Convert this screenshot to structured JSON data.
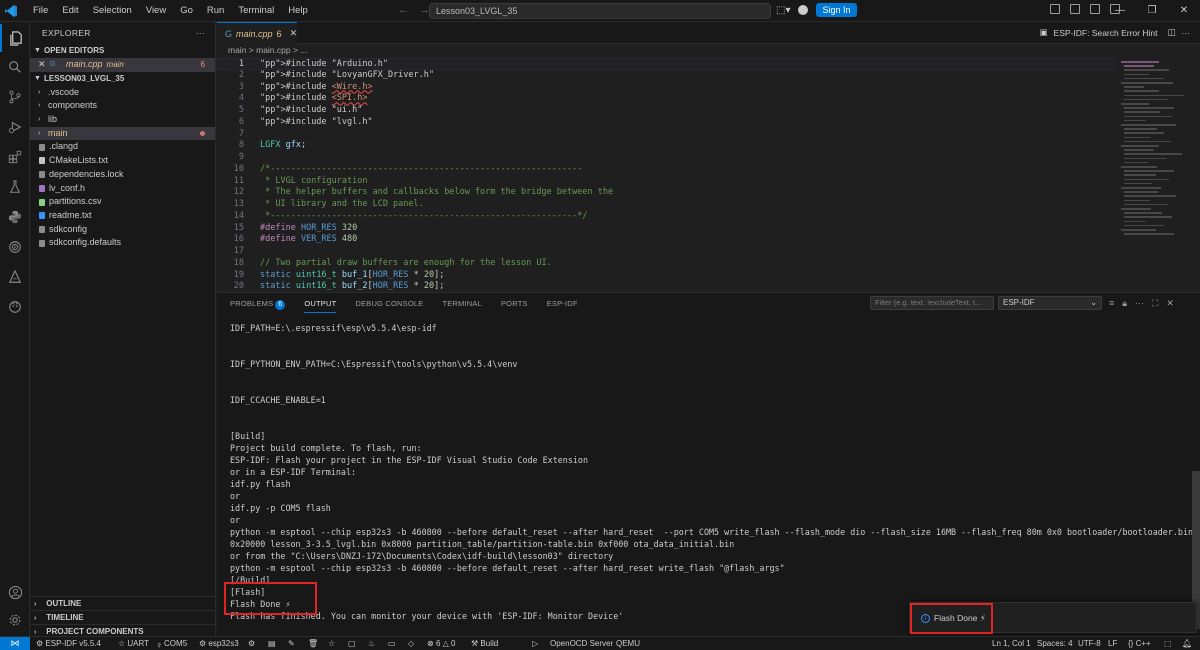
{
  "titlebar": {
    "menu": [
      "File",
      "Edit",
      "Selection",
      "View",
      "Go",
      "Run",
      "Terminal",
      "Help"
    ],
    "command_center": "Lesson03_LVGL_35",
    "sign_in": "Sign In"
  },
  "sidebar": {
    "title": "EXPLORER",
    "open_editors": "OPEN EDITORS",
    "open_file": "main.cpp",
    "open_file_dir": "main",
    "open_file_problems": "6",
    "project": "LESSON03_LVGL_35",
    "items": [
      {
        "label": "vscode",
        "type": "folder"
      },
      {
        "label": "components",
        "type": "folder"
      },
      {
        "label": "lib",
        "type": "folder"
      },
      {
        "label": "main",
        "type": "folder-modified"
      },
      {
        "label": ".clangd",
        "type": "file"
      },
      {
        "label": "CMakeLists.txt",
        "type": "cmake"
      },
      {
        "label": "dependencies.lock",
        "type": "file"
      },
      {
        "label": "lv_conf.h",
        "type": "header"
      },
      {
        "label": "partitions.csv",
        "type": "csv"
      },
      {
        "label": "readme.txt",
        "type": "info"
      },
      {
        "label": "sdkconfig",
        "type": "file"
      },
      {
        "label": "sdkconfig.defaults",
        "type": "file"
      }
    ],
    "outline": "OUTLINE",
    "timeline": "TIMELINE",
    "project_components": "PROJECT COMPONENTS"
  },
  "editor": {
    "tab_label": "main.cpp",
    "tab_problems": "6",
    "breadcrumb": "main > main.cpp > ...",
    "right_action": "ESP-IDF: Search Error Hint",
    "lines": [
      "#include \"Arduino.h\"",
      "#include \"LovyanGFX_Driver.h\"",
      "#include <Wire.h>",
      "#include <SPI.h>",
      "#include \"ui.h\"",
      "#include \"lvgl.h\"",
      "",
      "LGFX gfx;",
      "",
      "/*-------------------------------------------------------------",
      " * LVGL configuration",
      " * The helper buffers and callbacks below form the bridge between the",
      " * UI library and the LCD panel.",
      " *------------------------------------------------------------*/",
      "#define HOR_RES 320",
      "#define VER_RES 480",
      "",
      "// Two partial draw buffers are enough for the lesson UI.",
      "static uint16_t buf_1[HOR_RES * 20];",
      "static uint16_t buf_2[HOR_RES * 20];"
    ]
  },
  "panel": {
    "tabs": [
      "PROBLEMS",
      "OUTPUT",
      "DEBUG CONSOLE",
      "TERMINAL",
      "PORTS",
      "ESP-IDF"
    ],
    "problems_count": "6",
    "filter_placeholder": "Filter (e.g. text, !excludeText, t...",
    "channel": "ESP-IDF",
    "output_lines": [
      "IDF_PATH=E:\\.espressif\\esp\\v5.5.4\\esp-idf",
      "",
      "",
      "IDF_PYTHON_ENV_PATH=C:\\Espressif\\tools\\python\\v5.5.4\\venv",
      "",
      "",
      "IDF_CCACHE_ENABLE=1",
      "",
      "",
      "[Build]",
      "Project build complete. To flash, run:",
      "ESP-IDF: Flash your project in the ESP-IDF Visual Studio Code Extension",
      "or in a ESP-IDF Terminal:",
      "idf.py flash",
      "or",
      "idf.py -p COM5 flash",
      "or",
      "python -m esptool --chip esp32s3 -b 460800 --before default_reset --after hard_reset  --port COM5 write_flash --flash_mode dio --flash_size 16MB --flash_freq 80m 0x0 bootloader/bootloader.bin",
      "0x20000 lesson_3-3.5_lvgl.bin 0x8000 partition_table/partition-table.bin 0xf000 ota_data_initial.bin",
      "or from the \"C:\\Users\\DNZJ-172\\Documents\\Codex\\idf-build\\lesson03\" directory",
      "python -m esptool --chip esp32s3 -b 460800 --before default_reset --after hard_reset write_flash \"@flash_args\"",
      "[/Build]",
      "[Flash]",
      "Flash Done ⚡",
      "Flash has finished. You can monitor your device with 'ESP-IDF: Monitor Device'"
    ]
  },
  "toast": {
    "message": "Flash Done ⚡"
  },
  "statusbar": {
    "esp_idf": "ESP-IDF v5.5.4",
    "uart": "UART",
    "port": "COM5",
    "target": "esp32s3",
    "problems": "6",
    "warnings": "0",
    "build": "Build",
    "openocd": "OpenOCD Server",
    "qemu": "QEMU",
    "position": "Ln 1, Col 1",
    "spaces": "Spaces: 4",
    "eol": "LF",
    "encoding": "UTF-8",
    "language": "C++"
  },
  "colors": {
    "accent": "#0078d4",
    "highlight_box": "#e02424",
    "problems": "#f48771"
  }
}
